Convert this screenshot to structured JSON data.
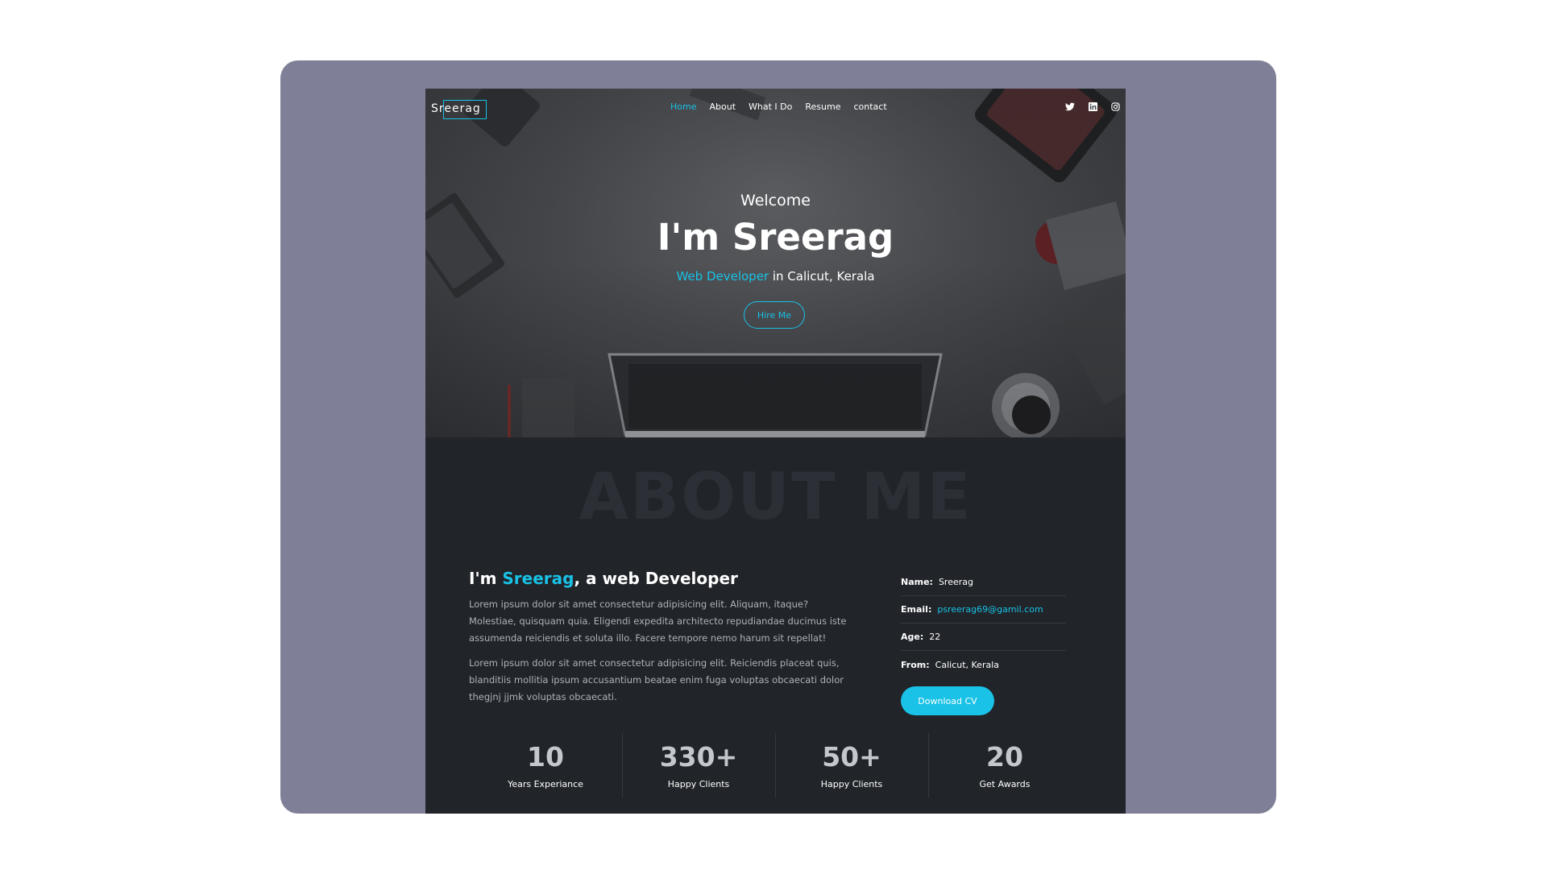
{
  "brand": {
    "logo_text": "Sreerag"
  },
  "nav": {
    "items": [
      {
        "label": "Home",
        "active": true
      },
      {
        "label": "About",
        "active": false
      },
      {
        "label": "What I Do",
        "active": false
      },
      {
        "label": "Resume",
        "active": false
      },
      {
        "label": "contact",
        "active": false
      }
    ]
  },
  "social": [
    "twitter-icon",
    "linkedin-icon",
    "instagram-icon"
  ],
  "hero": {
    "welcome": "Welcome",
    "title": "I'm Sreerag",
    "role": "Web Developer",
    "location": " in Calicut, Kerala",
    "cta": "Hire Me"
  },
  "about": {
    "bg_title": "ABOUT ME",
    "heading_prefix": "I'm ",
    "heading_name": "Sreerag",
    "heading_suffix": ", a web Developer",
    "para1": "Lorem ipsum dolor sit amet consectetur adipisicing elit. Aliquam, itaque? Molestiae, quisquam quia. Eligendi expedita architecto repudiandae ducimus iste assumenda reiciendis et soluta illo. Facere tempore nemo harum sit repellat!",
    "para2": "Lorem ipsum dolor sit amet consectetur adipisicing elit. Reiciendis placeat quis, blanditiis mollitia ipsum accusantium beatae enim fuga voluptas obcaecati dolor thegjnj jjmk voluptas obcaecati.",
    "info": [
      {
        "label": "Name:",
        "value": "Sreerag"
      },
      {
        "label": "Email:",
        "value": "psreerag69@gamil.com"
      },
      {
        "label": "Age:",
        "value": "22"
      },
      {
        "label": "From:",
        "value": "Calicut, Kerala"
      }
    ],
    "download": "Download CV"
  },
  "stats": [
    {
      "num": "10",
      "label": "Years Experiance"
    },
    {
      "num": "330+",
      "label": "Happy Clients"
    },
    {
      "num": "50+",
      "label": "Happy Clients"
    },
    {
      "num": "20",
      "label": "Get Awards"
    }
  ],
  "colors": {
    "accent": "#19c2e6",
    "frame": "#7f8097",
    "dark": "#212429"
  }
}
